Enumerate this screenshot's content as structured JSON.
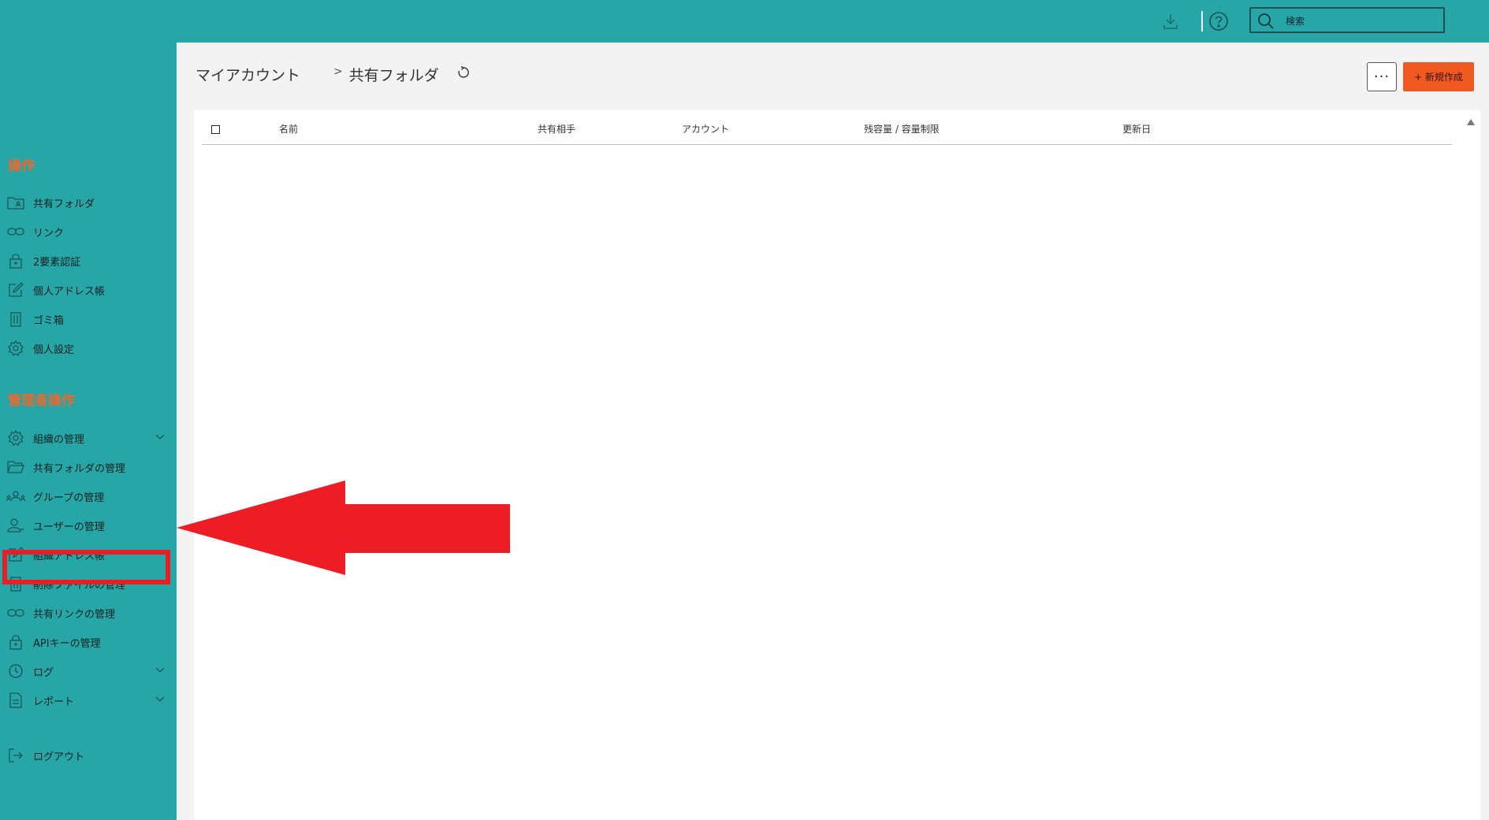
{
  "topbar": {
    "download_icon": "download-icon",
    "help_icon": "help-icon",
    "search_placeholder": "検索"
  },
  "sidebar": {
    "section_ops": "操作",
    "ops_items": [
      {
        "label": "共有フォルダ",
        "icon": "shared-folder-icon"
      },
      {
        "label": "リンク",
        "icon": "link-icon"
      },
      {
        "label": "2要素認証",
        "icon": "lock-icon"
      },
      {
        "label": "個人アドレス帳",
        "icon": "edit-icon"
      },
      {
        "label": "ゴミ箱",
        "icon": "trash-icon"
      },
      {
        "label": "個人設定",
        "icon": "gear-icon"
      }
    ],
    "section_admin": "管理者操作",
    "admin_items": [
      {
        "label": "組織の管理",
        "icon": "gear-icon",
        "expandable": true
      },
      {
        "label": "共有フォルダの管理",
        "icon": "folder-open-icon"
      },
      {
        "label": "グループの管理",
        "icon": "group-icon"
      },
      {
        "label": "ユーザーの管理",
        "icon": "user-icon",
        "highlighted": true
      },
      {
        "label": "組織アドレス帳",
        "icon": "edit-icon"
      },
      {
        "label": "削除ファイルの管理",
        "icon": "trash-icon"
      },
      {
        "label": "共有リンクの管理",
        "icon": "link-icon"
      },
      {
        "label": "APIキーの管理",
        "icon": "lock-icon"
      },
      {
        "label": "ログ",
        "icon": "clock-icon",
        "expandable": true
      },
      {
        "label": "レポート",
        "icon": "document-icon",
        "expandable": true
      }
    ],
    "logout": "ログアウト"
  },
  "main": {
    "breadcrumb": [
      "マイアカウント",
      "共有フォルダ"
    ],
    "more_label": "···",
    "new_label": "+ 新規作成",
    "columns": [
      "名前",
      "共有相手",
      "アカウント",
      "残容量 / 容量制限",
      "更新日"
    ]
  },
  "colors": {
    "teal": "#26a6a6",
    "orange": "#f0591f",
    "section_title": "#f2662b",
    "annotation_red": "#e81d25"
  }
}
